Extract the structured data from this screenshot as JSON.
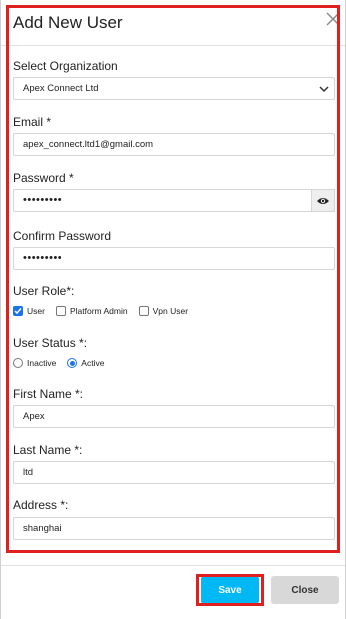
{
  "dialog": {
    "title": "Add New User",
    "close_icon": "close-icon"
  },
  "form": {
    "organization": {
      "label": "Select Organization",
      "value": "Apex Connect Ltd"
    },
    "email": {
      "label": "Email *",
      "value": "apex_connect.ltd1@gmail.com"
    },
    "password": {
      "label": "Password *",
      "value": "•••••••••",
      "toggle_icon": "eye-icon"
    },
    "confirm_password": {
      "label": "Confirm Password",
      "value": "•••••••••"
    },
    "user_role": {
      "label": "User Role*:",
      "options": [
        {
          "label": "User",
          "checked": true
        },
        {
          "label": "Platform Admin",
          "checked": false
        },
        {
          "label": "Vpn User",
          "checked": false
        }
      ]
    },
    "user_status": {
      "label": "User Status *:",
      "options": [
        {
          "label": "Inactive",
          "selected": false
        },
        {
          "label": "Active",
          "selected": true
        }
      ]
    },
    "first_name": {
      "label": "First Name *:",
      "value": "Apex"
    },
    "last_name": {
      "label": "Last Name *:",
      "value": "ltd"
    },
    "address": {
      "label": "Address *:",
      "value": "shanghai"
    }
  },
  "footer": {
    "save_label": "Save",
    "close_label": "Close"
  },
  "colors": {
    "highlight": "#e0201f",
    "save_button": "#00b8f4",
    "accent": "#1a73e8"
  }
}
